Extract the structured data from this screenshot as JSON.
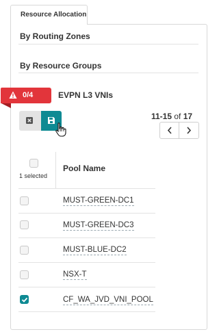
{
  "tab": {
    "label": "Resource Allocation"
  },
  "sections": {
    "routing_zones": "By Routing Zones",
    "resource_groups": "By Resource Groups"
  },
  "alert_badge": {
    "icon": "warning-triangle-icon",
    "count": "0/4",
    "color": "#e2353b"
  },
  "group_title": "EVPN L3 VNIs",
  "toolbar": {
    "cancel_icon": "close-box-icon",
    "save_icon": "floppy-disk-icon",
    "save_color": "#0e8a93"
  },
  "pagination": {
    "range": "11-15",
    "of_label": "of",
    "total": "17"
  },
  "table": {
    "selected_label": "1 selected",
    "column_header": "Pool Name",
    "rows": [
      {
        "name": "MUST-GREEN-DC1",
        "checked": false
      },
      {
        "name": "MUST-GREEN-DC3",
        "checked": false
      },
      {
        "name": "MUST-BLUE-DC2",
        "checked": false
      },
      {
        "name": "NSX-T",
        "checked": false
      },
      {
        "name": "CF_WA_JVD_VNI_POOL",
        "checked": true
      }
    ]
  }
}
